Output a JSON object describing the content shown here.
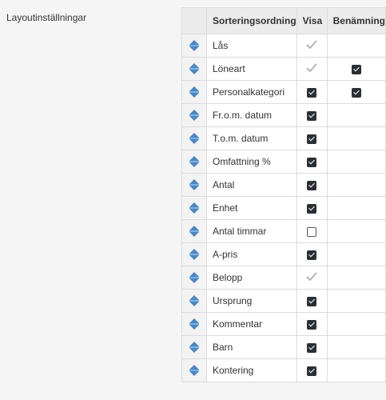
{
  "section": {
    "label": "Layoutinställningar"
  },
  "table": {
    "headers": {
      "sort": "Sorteringsordning",
      "visa": "Visa",
      "benamning": "Benämning"
    },
    "rows": [
      {
        "name": "Lås",
        "visa": "locked",
        "benamning": "none"
      },
      {
        "name": "Löneart",
        "visa": "locked",
        "benamning": "checked"
      },
      {
        "name": "Personalkategori",
        "visa": "checked",
        "benamning": "checked"
      },
      {
        "name": "Fr.o.m. datum",
        "visa": "checked",
        "benamning": "none"
      },
      {
        "name": "T.o.m. datum",
        "visa": "checked",
        "benamning": "none"
      },
      {
        "name": "Omfattning %",
        "visa": "checked",
        "benamning": "none"
      },
      {
        "name": "Antal",
        "visa": "checked",
        "benamning": "none"
      },
      {
        "name": "Enhet",
        "visa": "checked",
        "benamning": "none"
      },
      {
        "name": "Antal timmar",
        "visa": "unchecked",
        "benamning": "none"
      },
      {
        "name": "A-pris",
        "visa": "checked",
        "benamning": "none"
      },
      {
        "name": "Belopp",
        "visa": "locked",
        "benamning": "none"
      },
      {
        "name": "Ursprung",
        "visa": "checked",
        "benamning": "none"
      },
      {
        "name": "Kommentar",
        "visa": "checked",
        "benamning": "none"
      },
      {
        "name": "Barn",
        "visa": "checked",
        "benamning": "none"
      },
      {
        "name": "Kontering",
        "visa": "checked",
        "benamning": "none"
      }
    ]
  },
  "icons": {
    "row_handle": "sort-arrows-icon",
    "locked_check": "disabled-check-icon"
  },
  "colors": {
    "handle_blue": "#4a86c5",
    "checkbox_dark": "#2b2f33",
    "locked_grey": "#b5b5b5"
  }
}
